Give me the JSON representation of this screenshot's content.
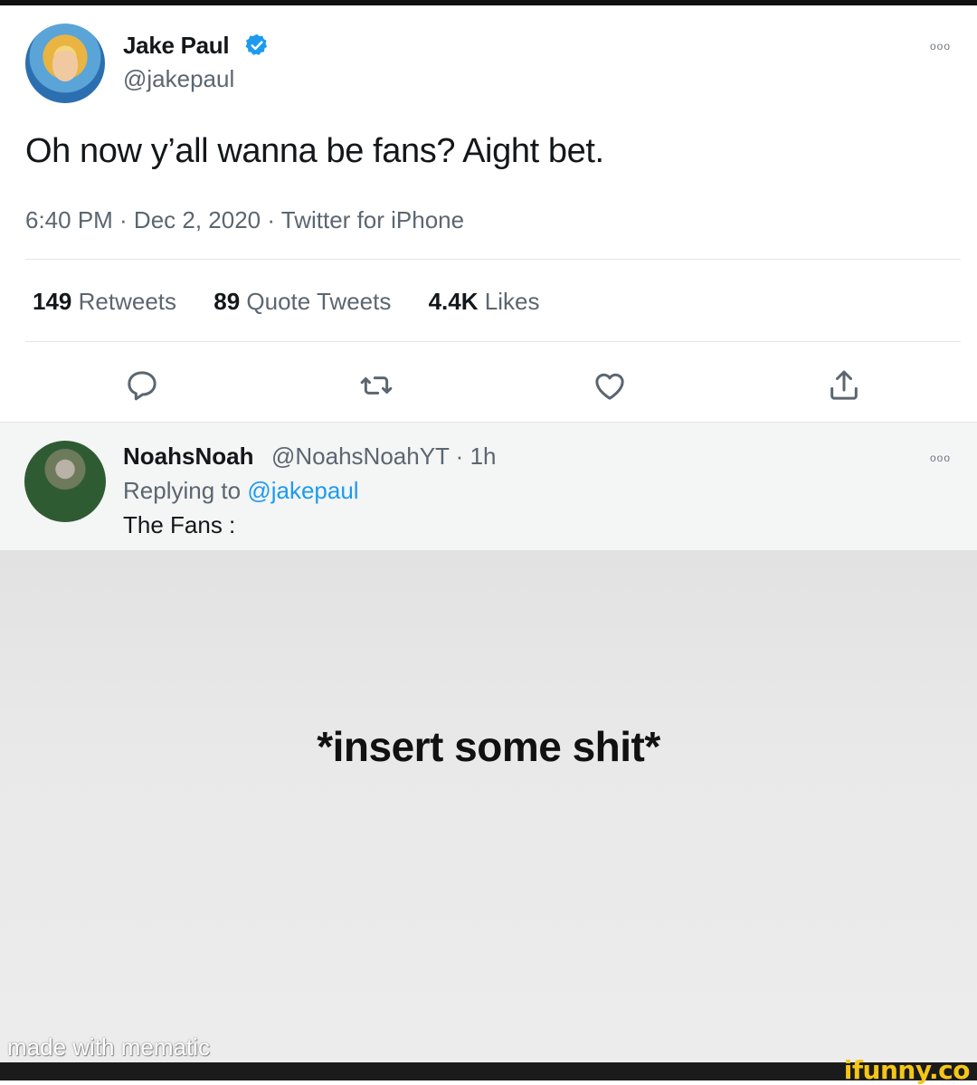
{
  "tweet": {
    "author_name": "Jake Paul",
    "handle": "@jakepaul",
    "text": "Oh now y’all wanna be fans? Aight bet.",
    "meta": "6:40 PM · Dec 2, 2020 · Twitter for iPhone",
    "more": "ooo",
    "stats": {
      "retweets_count": "149",
      "retweets_label": "Retweets",
      "quotes_count": "89",
      "quotes_label": "Quote Tweets",
      "likes_count": "4.4K",
      "likes_label": "Likes"
    }
  },
  "reply": {
    "author_name": "NoahsNoah",
    "handle_time": "@NoahsNoahYT · 1h",
    "replying_prefix": "Replying to",
    "replying_mention": "@jakepaul",
    "text": "The Fans :",
    "more": "ooo"
  },
  "meme": {
    "caption": "*insert some shit*",
    "watermark": "made with mematic"
  },
  "branding": {
    "ifunny": "ifunny.co"
  },
  "colors": {
    "accent": "#1d9bf0",
    "secondary_text": "#5b6670",
    "meme_bg": "#e9e9e9",
    "ifunny_yellow": "#f5c518"
  }
}
